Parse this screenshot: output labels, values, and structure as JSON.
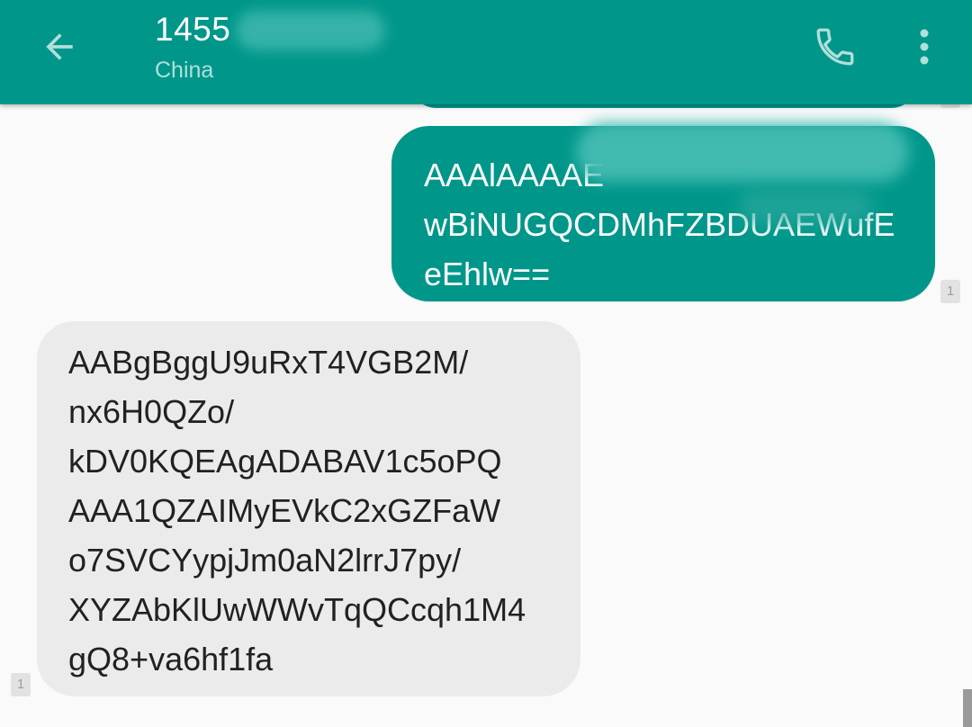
{
  "header": {
    "title": "1455",
    "subtitle": "China",
    "back_icon": "arrow-left-icon",
    "call_icon": "phone-icon",
    "more_icon": "more-vert-icon",
    "bar_color": "#00978a"
  },
  "messages": [
    {
      "direction": "outgoing",
      "lines": [
        "AAAlAAAAE",
        "wBiNUGQCDMhFZBDUAEWufE",
        "eEhlw=="
      ],
      "sim_badge": "1",
      "bubble_color": "#00978a"
    },
    {
      "direction": "incoming",
      "lines": [
        "AABgBggU9uRxT4VGB2M/",
        "nx6H0QZo/",
        "kDV0KQEAgADABAV1c5oPQ",
        "AAA1QZAIMyEVkC2xGZFaW",
        "o7SVCYypjJm0aN2lrrJ7py/",
        "XYZAbKlUwWWvTqQCcqh1M4",
        "gQ8+va6hf1fa"
      ],
      "sim_badge": "1",
      "bubble_color": "#ebebeb"
    }
  ]
}
